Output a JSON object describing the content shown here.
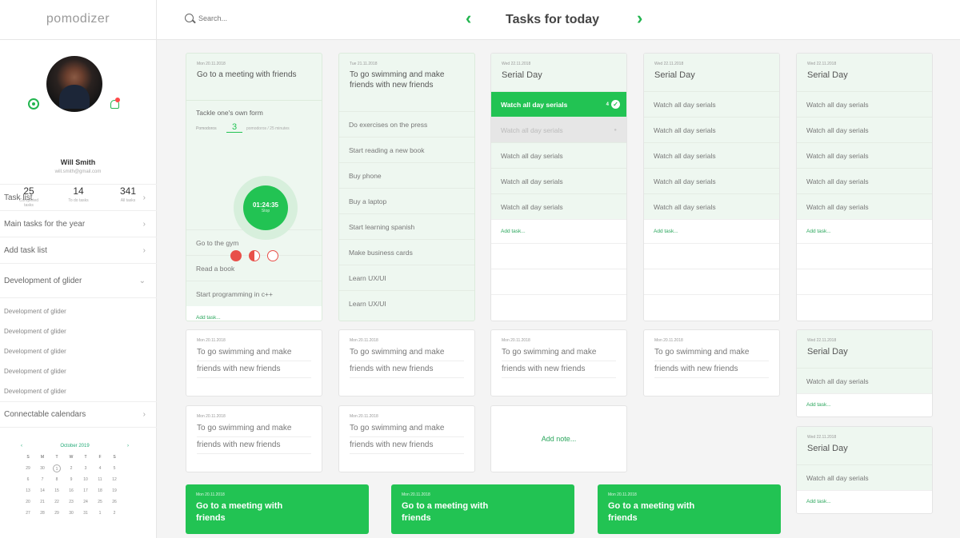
{
  "app": {
    "name": "pomodizer"
  },
  "search": {
    "placeholder": "Search..."
  },
  "header": {
    "title": "Tasks for today",
    "prev_icon": "‹",
    "next_icon": "›"
  },
  "user": {
    "name": "Will Smith",
    "email": "will.smith@gmail.com",
    "stats": [
      {
        "value": "25",
        "label": "Completed tasks"
      },
      {
        "value": "14",
        "label": "To do tasks"
      },
      {
        "value": "341",
        "label": "All tasks"
      }
    ]
  },
  "nav": {
    "task_list": "Task list",
    "main_tasks": "Main tasks for the year",
    "add_task_list": "Add task list",
    "development": "Development of glider",
    "sub_items": [
      "Development of glider",
      "Development of glider",
      "Development of glider",
      "Development of glider",
      "Development of glider"
    ],
    "calendars": "Connectable calendars"
  },
  "calendar": {
    "month": "October 2019",
    "prev": "‹",
    "next": "›",
    "weekdays": [
      "S",
      "M",
      "T",
      "W",
      "T",
      "F",
      "S"
    ],
    "days": [
      "29",
      "30",
      "1",
      "2",
      "3",
      "4",
      "5",
      "6",
      "7",
      "8",
      "9",
      "10",
      "11",
      "12",
      "13",
      "14",
      "15",
      "16",
      "17",
      "18",
      "19",
      "20",
      "21",
      "22",
      "23",
      "24",
      "25",
      "26",
      "27",
      "28",
      "29",
      "30",
      "31",
      "1",
      "2"
    ],
    "selected": "1"
  },
  "col1": {
    "date": "Mon 20.11.2018",
    "title": "Go to a meeting with friends",
    "active_task": "Tackle one's own form",
    "pom_label": "Pomodoros",
    "pom_count": "3",
    "pom_note": "pomodoros / 25 minutes",
    "timer": "01:24:35",
    "timer_sub": "Stop",
    "tasks": [
      "Go to the gym",
      "Read a book",
      "Start programming in c++"
    ],
    "add": "Add task..."
  },
  "col2": {
    "date": "Tue 21.11.2018",
    "title": "To go swimming and make friends with new friends",
    "tasks": [
      "Do exercises on the press",
      "Start reading a new book",
      "Buy phone",
      "Buy a laptop",
      "Start learning spanish",
      "Make business cards",
      "Learn UX/UI",
      "Learn UX/UI"
    ]
  },
  "col3": {
    "date": "Wed 22.11.2018",
    "title": "Serial Day",
    "active": "Watch all day serials",
    "active_count": "4",
    "dim": "Watch all day serials",
    "tasks": [
      "Watch all day serials",
      "Watch all day serials",
      "Watch all day serials"
    ],
    "add": "Add task..."
  },
  "col4": {
    "date": "Wed 22.11.2018",
    "title": "Serial Day",
    "tasks": [
      "Watch all day serials",
      "Watch all day serials",
      "Watch all day serials",
      "Watch all day serials",
      "Watch all day serials"
    ],
    "add": "Add task..."
  },
  "col5": {
    "date": "Wed 22.11.2018",
    "title": "Serial Day",
    "tasks": [
      "Watch all day serials",
      "Watch all day serials",
      "Watch all day serials",
      "Watch all day serials",
      "Watch all day serials"
    ],
    "add": "Add task..."
  },
  "notes": {
    "date": "Mon 20.11.2018",
    "line1": "To go swimming and make",
    "line2": "friends with new friends",
    "add_note": "Add note..."
  },
  "serial_small": {
    "date": "Wed 22.11.2018",
    "title": "Serial Day",
    "task": "Watch all day serials",
    "add": "Add task..."
  },
  "green_cards": {
    "date": "Mon 20.11.2018",
    "title": "Go to a meeting with friends"
  },
  "colors": {
    "accent": "#22c353",
    "light_green": "#eef7f0",
    "tomato": "#e8504a"
  }
}
